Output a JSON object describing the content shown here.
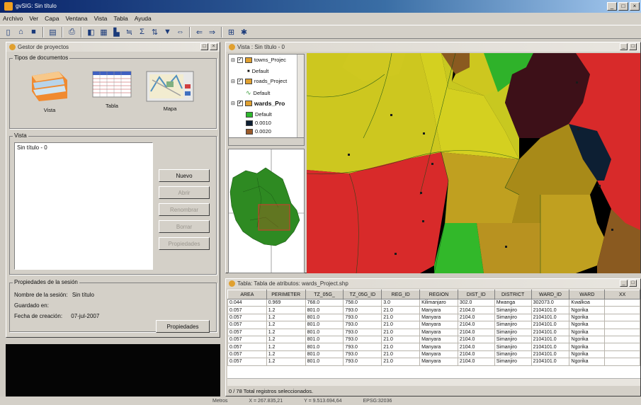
{
  "window": {
    "title": "gvSIG: Sin título"
  },
  "menu": [
    "Archivo",
    "Ver",
    "Capa",
    "Ventana",
    "Vista",
    "Tabla",
    "Ayuda"
  ],
  "toolbar_icons": [
    "new-doc-icon",
    "open-icon",
    "save-icon",
    "layout-icon",
    "print-icon",
    "add-layer-icon",
    "table-icon",
    "chart-icon",
    "filter-icon",
    "sum-icon",
    "sort-icon",
    "funnel-icon",
    "link-icon",
    "nav-back-icon",
    "nav-forward-icon",
    "zoom-icon",
    "tool-icon"
  ],
  "project_manager": {
    "title": "Gestor de proyectos",
    "doc_types_label": "Tipos de documentos",
    "doc_types": [
      "Vista",
      "Tabla",
      "Mapa"
    ],
    "view_group_label": "Vista",
    "views": [
      "Sin título - 0"
    ],
    "buttons": {
      "new": "Nuevo",
      "open": "Abrir",
      "rename": "Renombrar",
      "delete": "Borrar",
      "props": "Propiedades"
    },
    "session_group_label": "Propiedades de la sesión",
    "session": {
      "name_label": "Nombre de la sesión:",
      "name": "Sin título",
      "saved_label": "Guardado en:",
      "date_label": "Fecha de creación:",
      "date": "07-jul-2007",
      "props_button": "Propiedades"
    }
  },
  "view": {
    "title": "Vista : Sin título - 0",
    "layers": [
      {
        "name": "towns_Projec",
        "legend": "Default"
      },
      {
        "name": "roads_Project",
        "legend": "Default"
      },
      {
        "name": "wards_Pro",
        "legend": [
          "Default",
          "0.0010",
          "0.0020"
        ]
      }
    ],
    "legend_colors": [
      "#2db82d",
      "#0d1f33",
      "#9a5a2a"
    ]
  },
  "table_window": {
    "title": "Tabla: Tabla de atributos: wards_Project.shp",
    "columns": [
      "AREA",
      "PERIMETER",
      "TZ_05G_",
      "TZ_05G_ID",
      "REG_ID",
      "REGION",
      "DIST_ID",
      "DISTRICT",
      "WARD_ID",
      "WARD",
      "XX"
    ],
    "rows": [
      [
        "0.044",
        "0.969",
        "768.0",
        "758.0",
        "3.0",
        "Kilimanjaro",
        "302.0",
        "Mwanga",
        "302073.0",
        "Kwalkoa",
        ""
      ],
      [
        "0.057",
        "1.2",
        "801.0",
        "793.0",
        "21.0",
        "Manyara",
        "2104.0",
        "Simanjiro",
        "2104101.0",
        "Ngorika",
        ""
      ],
      [
        "0.057",
        "1.2",
        "801.0",
        "793.0",
        "21.0",
        "Manyara",
        "2104.0",
        "Simanjiro",
        "2104101.0",
        "Ngorika",
        ""
      ],
      [
        "0.057",
        "1.2",
        "801.0",
        "793.0",
        "21.0",
        "Manyara",
        "2104.0",
        "Simanjiro",
        "2104101.0",
        "Ngorika",
        ""
      ],
      [
        "0.057",
        "1.2",
        "801.0",
        "793.0",
        "21.0",
        "Manyara",
        "2104.0",
        "Simanjiro",
        "2104101.0",
        "Ngorika",
        ""
      ],
      [
        "0.057",
        "1.2",
        "801.0",
        "793.0",
        "21.0",
        "Manyara",
        "2104.0",
        "Simanjiro",
        "2104101.0",
        "Ngorika",
        ""
      ],
      [
        "0.057",
        "1.2",
        "801.0",
        "793.0",
        "21.0",
        "Manyara",
        "2104.0",
        "Simanjiro",
        "2104101.0",
        "Ngorika",
        ""
      ],
      [
        "0.057",
        "1.2",
        "801.0",
        "793.0",
        "21.0",
        "Manyara",
        "2104.0",
        "Simanjiro",
        "2104101.0",
        "Ngorika",
        ""
      ],
      [
        "0.057",
        "1.2",
        "801.0",
        "793.0",
        "21.0",
        "Manyara",
        "2104.0",
        "Simanjiro",
        "2104101.0",
        "Ngorika",
        ""
      ]
    ],
    "selection_status": "0 / 78 Total registros seleccionados."
  },
  "status_bar": {
    "units": "Metros",
    "x": "X = 267.835,21",
    "y": "Y = 9.513.694,64",
    "epsg": "EPSG:32036"
  }
}
